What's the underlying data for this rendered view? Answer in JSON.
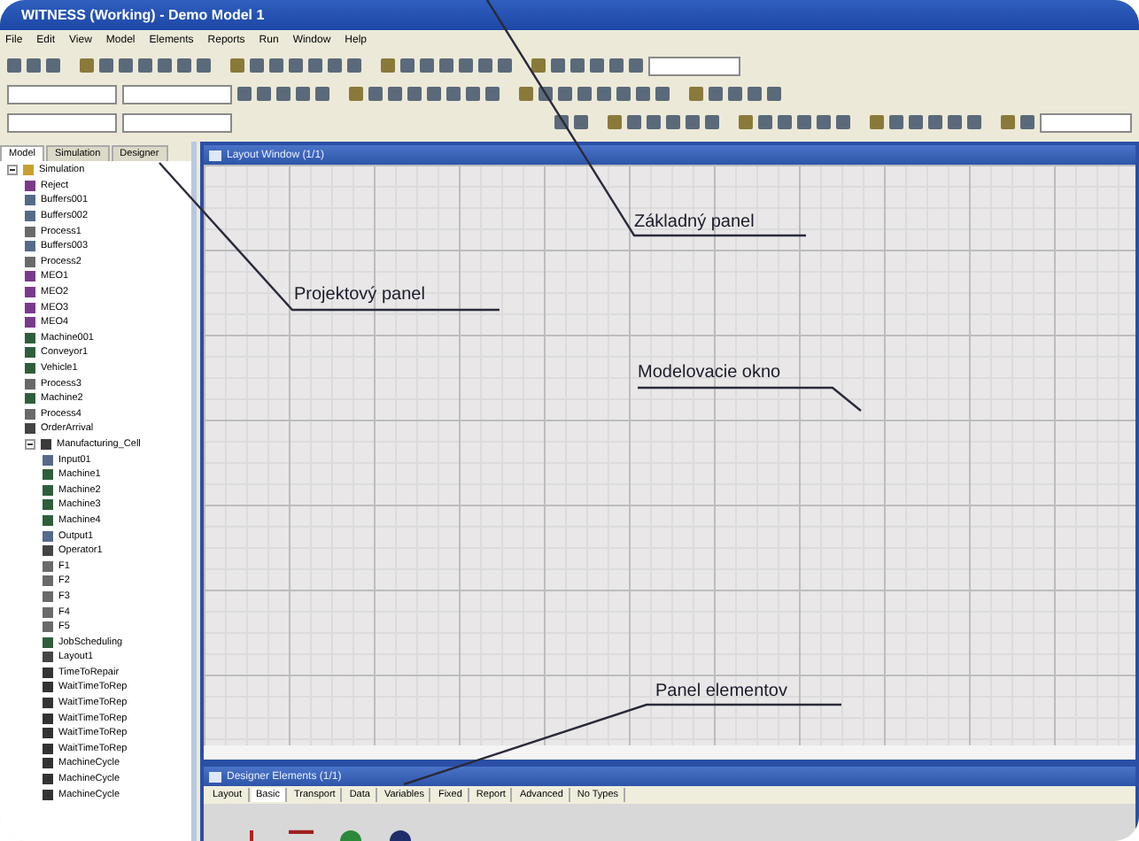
{
  "window": {
    "title": "WITNESS (Working) - Demo Model 1"
  },
  "menu": [
    "File",
    "Edit",
    "View",
    "Model",
    "Elements",
    "Reports",
    "Run",
    "Window",
    "Help"
  ],
  "project_panel": {
    "tabs": [
      {
        "label": "Model",
        "selected": true
      },
      {
        "label": "Simulation",
        "selected": false
      },
      {
        "label": "Designer",
        "selected": false
      }
    ],
    "tree": [
      {
        "label": "Simulation",
        "kind": "folder",
        "expanded": true,
        "children": [
          {
            "label": "Reject",
            "kind": "part"
          },
          {
            "label": "Buffers001",
            "kind": "buffer"
          },
          {
            "label": "Buffers002",
            "kind": "buffer"
          },
          {
            "label": "Process1",
            "kind": "process"
          },
          {
            "label": "Buffers003",
            "kind": "buffer"
          },
          {
            "label": "Process2",
            "kind": "process"
          },
          {
            "label": "MEO1",
            "kind": "part"
          },
          {
            "label": "MEO2",
            "kind": "part"
          },
          {
            "label": "MEO3",
            "kind": "part"
          },
          {
            "label": "MEO4",
            "kind": "part"
          },
          {
            "label": "Machine001",
            "kind": "machine"
          },
          {
            "label": "Conveyor1",
            "kind": "machine"
          },
          {
            "label": "Vehicle1",
            "kind": "machine"
          },
          {
            "label": "Process3",
            "kind": "process"
          },
          {
            "label": "Machine2",
            "kind": "machine"
          },
          {
            "label": "Process4",
            "kind": "process"
          },
          {
            "label": "OrderArrival",
            "kind": "variable"
          },
          {
            "label": "Manufacturing_Cell",
            "kind": "module",
            "expanded": true,
            "children": [
              {
                "label": "Input01",
                "kind": "buffer"
              },
              {
                "label": "Machine1",
                "kind": "machine"
              },
              {
                "label": "Machine2",
                "kind": "machine"
              },
              {
                "label": "Machine3",
                "kind": "machine"
              },
              {
                "label": "Machine4",
                "kind": "machine"
              },
              {
                "label": "Output1",
                "kind": "buffer"
              },
              {
                "label": "Operator1",
                "kind": "variable"
              },
              {
                "label": "F1",
                "kind": "process"
              },
              {
                "label": "F2",
                "kind": "process"
              },
              {
                "label": "F3",
                "kind": "process"
              },
              {
                "label": "F4",
                "kind": "process"
              },
              {
                "label": "F5",
                "kind": "process"
              },
              {
                "label": "JobScheduling",
                "kind": "machine"
              },
              {
                "label": "Layout1",
                "kind": "variable"
              },
              {
                "label": "TimeToRepair",
                "kind": "table"
              },
              {
                "label": "WaitTimeToRep",
                "kind": "table"
              },
              {
                "label": "WaitTimeToRep",
                "kind": "table"
              },
              {
                "label": "WaitTimeToRep",
                "kind": "table"
              },
              {
                "label": "WaitTimeToRep",
                "kind": "table"
              },
              {
                "label": "WaitTimeToRep",
                "kind": "table"
              },
              {
                "label": "MachineCycle",
                "kind": "table"
              },
              {
                "label": "MachineCycle",
                "kind": "table"
              },
              {
                "label": "MachineCycle",
                "kind": "table"
              }
            ]
          }
        ]
      }
    ]
  },
  "layout_window": {
    "title": "Layout Window (1/1)"
  },
  "elements_window": {
    "title": "Designer Elements (1/1)",
    "tabs": [
      {
        "label": "Layout",
        "selected": false
      },
      {
        "label": "Basic",
        "selected": true
      },
      {
        "label": "Transport",
        "selected": false
      },
      {
        "label": "Data",
        "selected": false
      },
      {
        "label": "Variables",
        "selected": false
      },
      {
        "label": "Fixed",
        "selected": false
      },
      {
        "label": "Report",
        "selected": false
      },
      {
        "label": "Advanced",
        "selected": false
      },
      {
        "label": "No Types",
        "selected": false
      }
    ]
  },
  "callouts": [
    {
      "text": "Základný panel"
    },
    {
      "text": "Projektový panel"
    },
    {
      "text": "Modelovacie okno"
    },
    {
      "text": "Panel elementov"
    }
  ]
}
